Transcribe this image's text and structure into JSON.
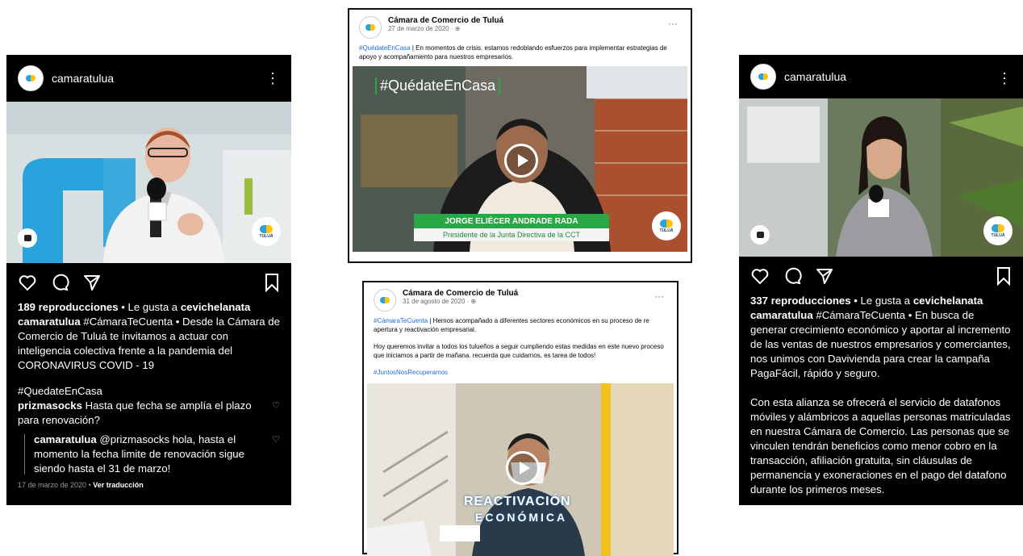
{
  "ig_left": {
    "username": "camaratulua",
    "views": "189 reproducciones",
    "liked_by_prefix": " • Le gusta a ",
    "liked_by_user": "cevichelanata",
    "caption_user": "camaratulua",
    "caption": " #CámaraTeCuenta • Desde la Cámara de Comercio de Tuluá te invitamos a actuar con inteligencia colectiva frente a la pandemia del CORONAVIRUS COVID - 19",
    "hashtag": "#QuedateEnCasa",
    "comment1_user": "prizmasocks",
    "comment1_text": " Hasta que fecha se amplía el plazo para renovación?",
    "reply_user": "camaratulua",
    "reply_text": " @prizmasocks hola, hasta el momento la fecha limite de renovación sigue siendo hasta el 31 de marzo!",
    "date": "17 de marzo de 2020",
    "date_sep": " • ",
    "translate": "Ver traducción",
    "logo_text": "TULUÁ"
  },
  "ig_right": {
    "username": "camaratulua",
    "views": "337 reproducciones",
    "liked_by_prefix": " • Le gusta a ",
    "liked_by_user": "cevichelanata",
    "caption_user": "camaratulua",
    "caption": " #CámaraTeCuenta • En busca de generar crecimiento económico y aportar al incremento de las ventas de nuestros empresarios y comerciantes, nos unimos con Davivienda para crear la campaña PagaFácil, rápido y seguro.",
    "caption2": "Con esta alianza se ofrecerá el servicio de datafonos móviles y alámbricos a aquellas personas matriculadas en nuestra Cámara de Comercio. Las personas que se vinculen tendrán beneficios como menor cobro en la transacción, afiliación gratuita, sin cláusulas de permanencia y exoneraciones en el pago del datafono durante los primeros meses.",
    "logo_text": "TULUÁ"
  },
  "fb_top": {
    "page_name": "Cámara de Comercio de Tuluá",
    "date": "27 de marzo de 2020 · ",
    "hashtag": "#QuédateEnCasa",
    "text": " | En momentos de crisis.  estamos redoblando esfuerzos para implementar estrategias de apoyo y acompañamiento para nuestros empresarios.",
    "overlay_tag": "#QuédateEnCasa",
    "lower_third_name": "JORGE ELIÉCER ANDRADE RADA",
    "lower_third_title": "Presidente de la Junta Directiva de la CCT",
    "dots": "···",
    "logo_text": "TULUÁ"
  },
  "fb_bot": {
    "page_name": "Cámara de Comercio de Tuluá",
    "date": "31 de agosto de 2020 · ",
    "hashtag": "#CámaraTeCuenta",
    "text": " | Hemos acompañado a diferentes sectores económicos en su proceso de re apertura y reactivación empresarial.",
    "text2": "Hoy queremos invitar a todos los tulueños a seguir cumpliendo estas medidas en este nuevo proceso que iniciamos a partir de mañana. recuerda que cuidarnos, es tarea de todos!",
    "hashtag2": "#JuntosNosRecuperamos",
    "overlay_line1": "REACTIVACIÓN",
    "overlay_line2": "ECONÓMICA",
    "dots": "···"
  },
  "colors": {
    "fb_link": "#216fdb",
    "cct_green": "#27a844",
    "brand_blue": "#2aa3dc",
    "brand_yellow": "#ffc20e"
  },
  "icons": [
    "heart-icon",
    "comment-icon",
    "share-icon",
    "bookmark-icon",
    "kebab-menu-icon",
    "play-icon",
    "camera-icon"
  ]
}
